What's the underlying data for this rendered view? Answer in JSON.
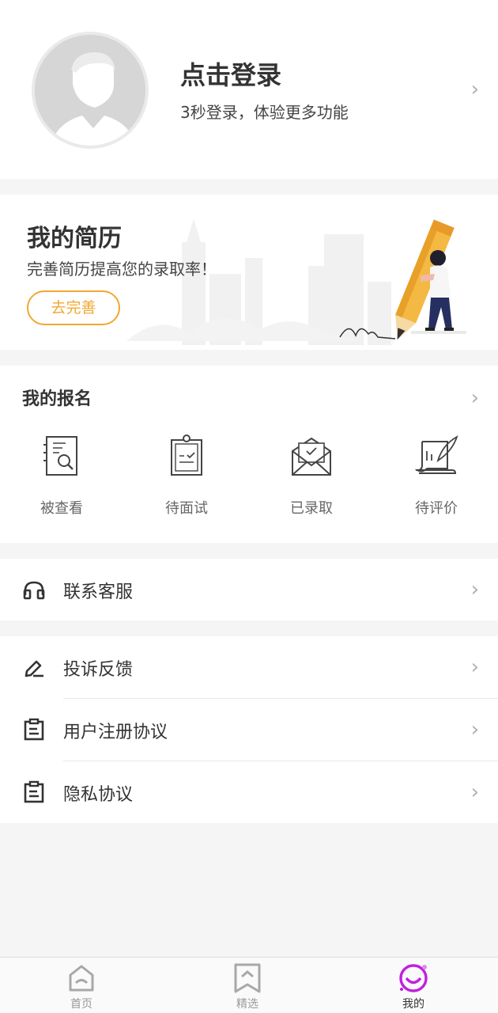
{
  "profile": {
    "title": "点击登录",
    "subtitle": "3秒登录，体验更多功能"
  },
  "resume": {
    "title": "我的简历",
    "description": "完善简历提高您的录取率！",
    "button": "去完善"
  },
  "applications": {
    "title": "我的报名",
    "items": [
      {
        "label": "被查看",
        "icon": "resume-search-icon"
      },
      {
        "label": "待面试",
        "icon": "clipboard-check-icon"
      },
      {
        "label": "已录取",
        "icon": "envelope-check-icon"
      },
      {
        "label": "待评价",
        "icon": "scroll-quill-icon"
      }
    ]
  },
  "menu": {
    "service": {
      "label": "联系客服",
      "icon": "headset-icon"
    },
    "feedback": {
      "label": "投诉反馈",
      "icon": "pencil-icon"
    },
    "agreement": {
      "label": "用户注册协议",
      "icon": "document-icon"
    },
    "privacy": {
      "label": "隐私协议",
      "icon": "document-icon"
    }
  },
  "tabbar": {
    "items": [
      {
        "label": "首页",
        "icon": "home-icon",
        "active": false
      },
      {
        "label": "精选",
        "icon": "bookmark-icon",
        "active": false
      },
      {
        "label": "我的",
        "icon": "smiley-profile-icon",
        "active": true
      }
    ]
  },
  "colors": {
    "accent": "#f0a830",
    "active_tab": "#c21fe0",
    "background": "#f5f5f5"
  }
}
